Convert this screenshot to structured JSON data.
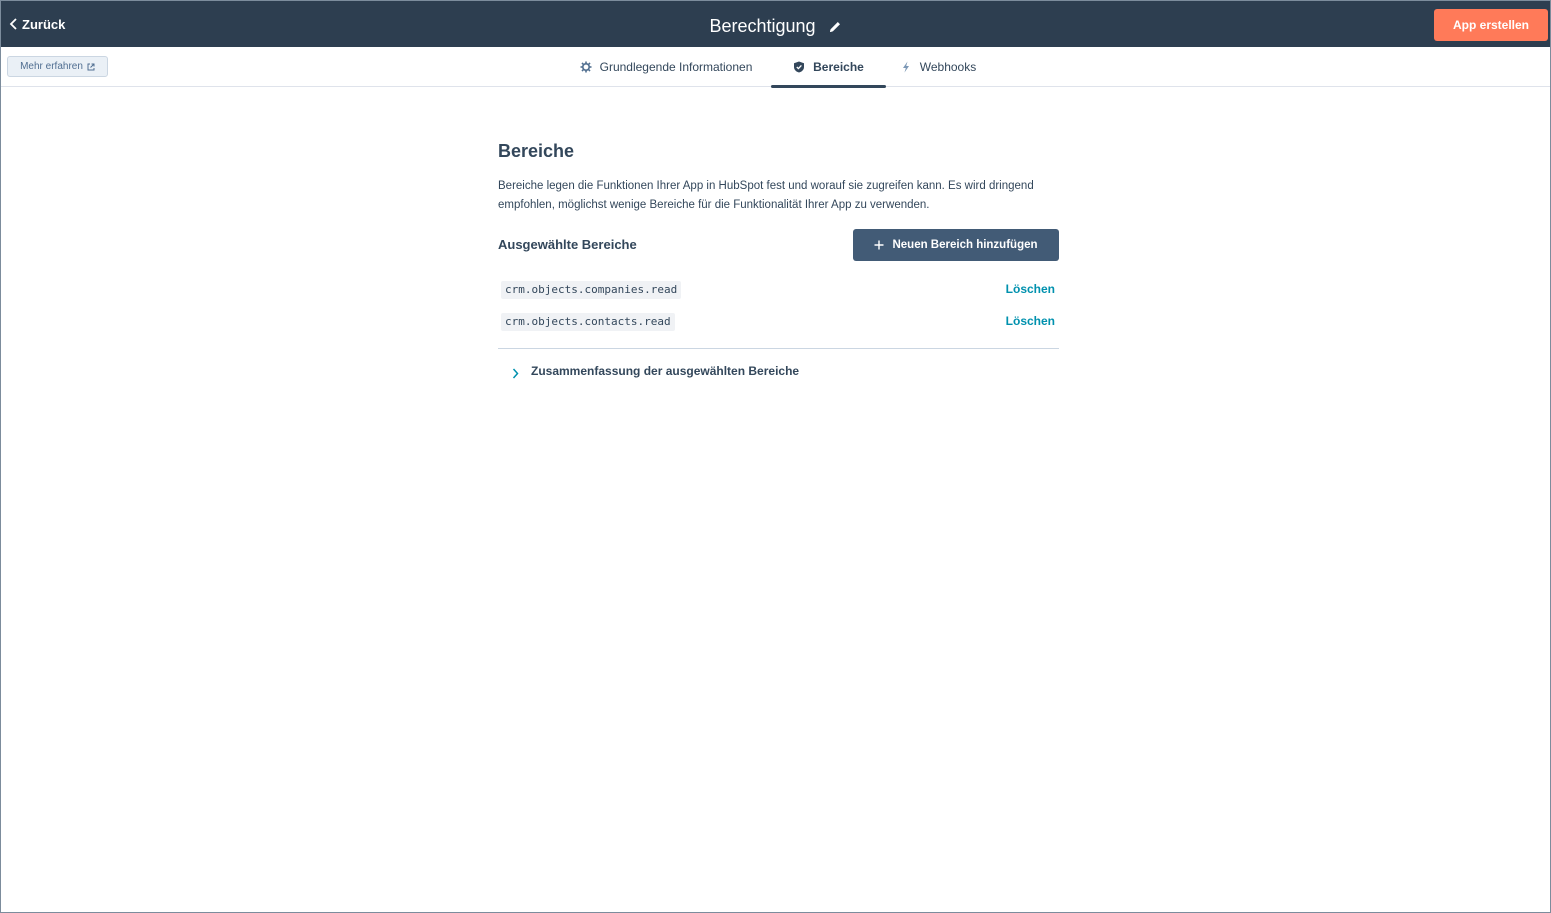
{
  "header": {
    "back_label": "Zurück",
    "title": "Berechtigung",
    "create_app_label": "App erstellen"
  },
  "tabbar": {
    "learn_more_label": "Mehr erfahren",
    "tabs": [
      {
        "label": "Grundlegende Informationen",
        "icon": "gear-icon",
        "active": false
      },
      {
        "label": "Bereiche",
        "icon": "shield-icon",
        "active": true
      },
      {
        "label": "Webhooks",
        "icon": "lightning-icon",
        "active": false
      }
    ]
  },
  "main": {
    "title": "Bereiche",
    "description": "Bereiche legen die Funktionen Ihrer App in HubSpot fest und worauf sie zugreifen kann. Es wird dringend empfohlen, möglichst wenige Bereiche für die Funktionalität Ihrer App zu verwenden.",
    "selected_label": "Ausgewählte Bereiche",
    "add_button_label": "Neuen Bereich hinzufügen",
    "scopes": [
      {
        "name": "crm.objects.companies.read",
        "delete_label": "Löschen"
      },
      {
        "name": "crm.objects.contacts.read",
        "delete_label": "Löschen"
      }
    ],
    "summary_label": "Zusammenfassung der ausgewählten Bereiche"
  },
  "colors": {
    "topbar": "#2d3e50",
    "primary_cta": "#ff7a59",
    "secondary_button": "#425b76",
    "link": "#0091ae",
    "text": "#33475b"
  }
}
